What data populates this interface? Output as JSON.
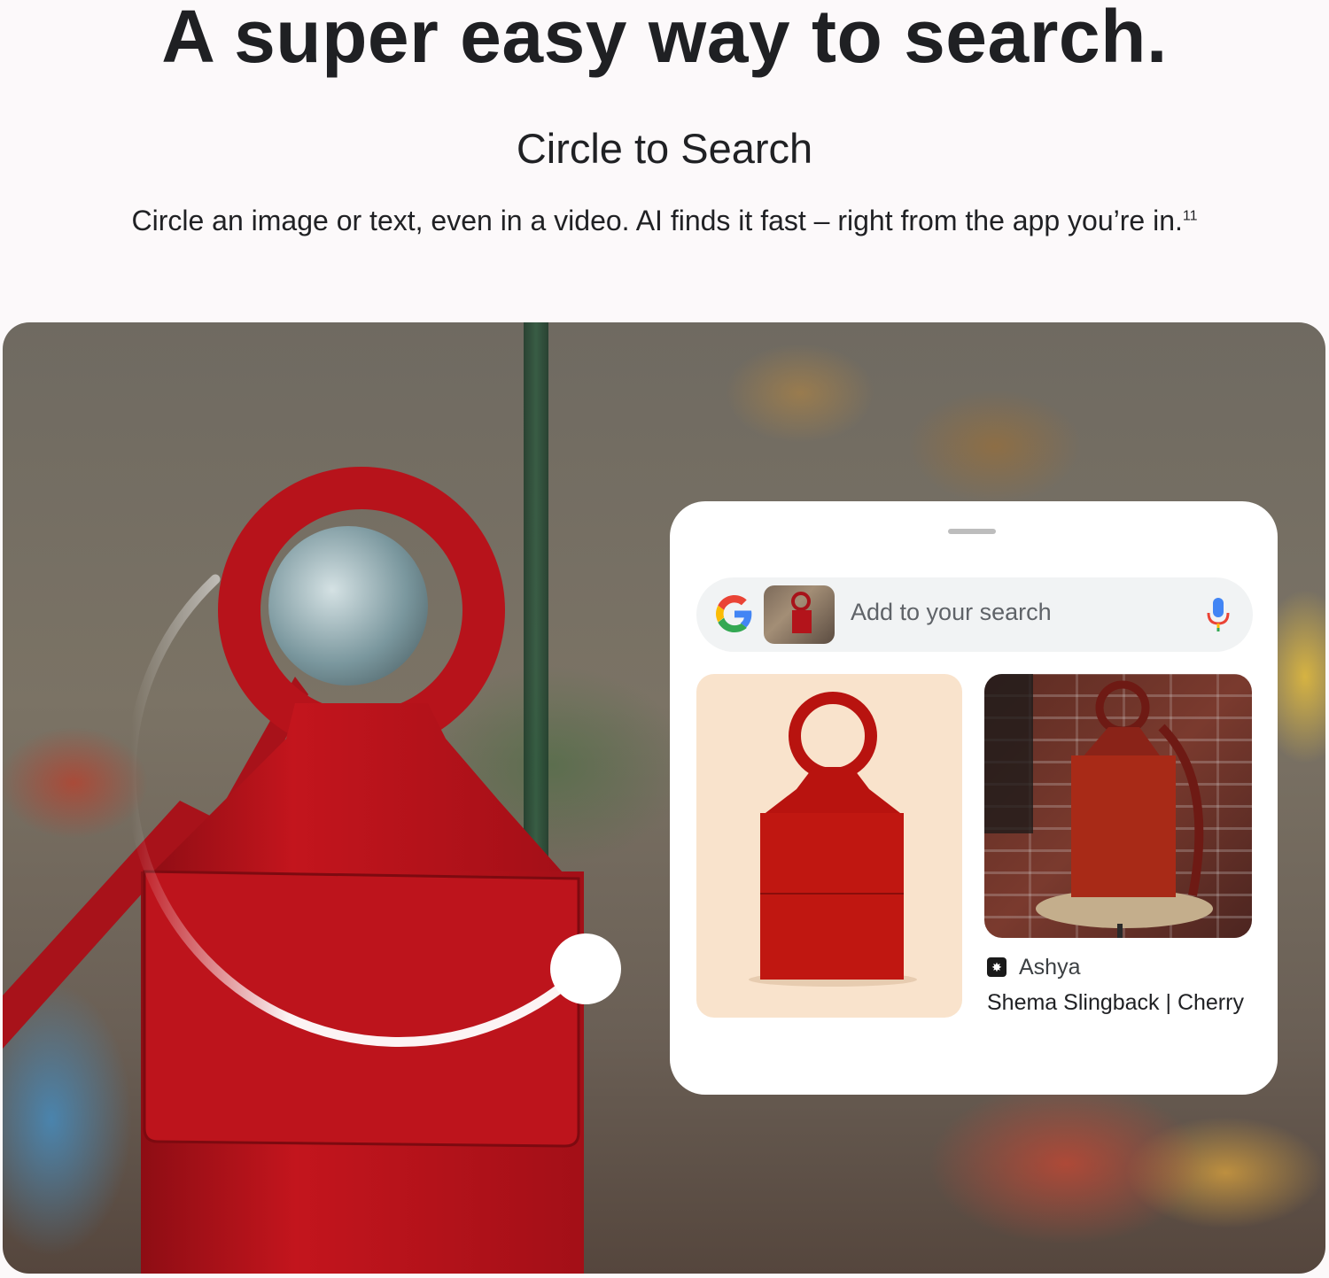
{
  "headline": "A super easy way to search.",
  "subheadline": "Circle to Search",
  "description": {
    "text": "Circle an image or text, even in a video. AI finds it fast – right from the app you’re in.",
    "footnote": "11"
  },
  "search_panel": {
    "search_placeholder": "Add to your search",
    "icons": {
      "logo": "google-g-icon",
      "voice": "mic-icon"
    },
    "result": {
      "store": "Ashya",
      "product": "Shema Slingback | Cherry"
    }
  },
  "colors": {
    "bag_red": "#b5141b",
    "panel_bg": "#ffffff",
    "search_bar_bg": "#f1f3f4"
  }
}
